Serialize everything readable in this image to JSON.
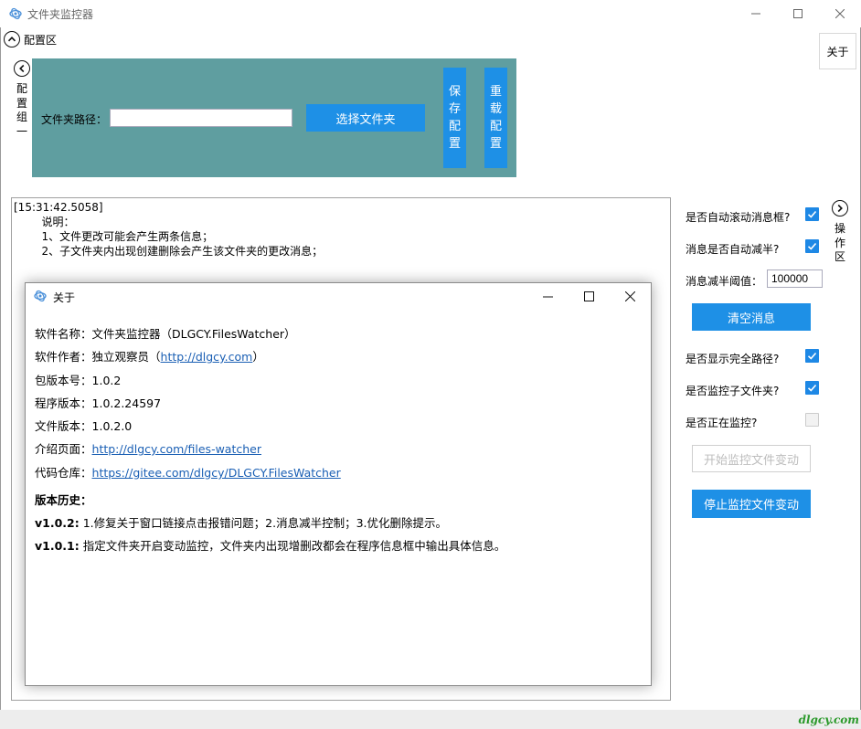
{
  "window": {
    "title": "文件夹监控器"
  },
  "config_area": {
    "header_label": "配置区",
    "group_label": "配置组一",
    "path_label": "文件夹路径：",
    "path_value": "",
    "select_folder_button": "选择文件夹",
    "save_config_button": "保存配置",
    "reload_config_button": "重载配置"
  },
  "about_button": "关于",
  "log": {
    "lines": [
      "[15:31:42.5058]",
      "        说明：",
      "        1、文件更改可能会产生两条信息；",
      "        2、子文件夹内出现创建删除会产生该文件夹的更改消息；"
    ]
  },
  "operation_area": {
    "label": "操作区",
    "auto_scroll_label": "是否自动滚动消息框?",
    "auto_scroll_checked": true,
    "auto_halve_label": "消息是否自动减半?",
    "auto_halve_checked": true,
    "halve_threshold_label": "消息减半阈值：",
    "halve_threshold_value": "100000",
    "clear_button": "清空消息",
    "show_full_path_label": "是否显示完全路径?",
    "show_full_path_checked": true,
    "monitor_subfolders_label": "是否监控子文件夹?",
    "monitor_subfolders_checked": true,
    "is_monitoring_label": "是否正在监控?",
    "is_monitoring_checked": false,
    "start_button": "开始监控文件变动",
    "stop_button": "停止监控文件变动"
  },
  "about_dialog": {
    "title": "关于",
    "software_name_label": "软件名称：",
    "software_name_value": "文件夹监控器（DLGCY.FilesWatcher）",
    "author_label": "软件作者：",
    "author_value": "独立观察员（",
    "author_link": "http://dlgcy.com",
    "author_close": "）",
    "package_version_label": "包版本号：",
    "package_version_value": "1.0.2",
    "program_version_label": "程序版本：",
    "program_version_value": "1.0.2.24597",
    "file_version_label": "文件版本：",
    "file_version_value": "1.0.2.0",
    "intro_page_label": "介绍页面：",
    "intro_page_link": "http://dlgcy.com/files-watcher",
    "repo_label": "代码仓库：",
    "repo_link": "https://gitee.com/dlgcy/DLGCY.FilesWatcher",
    "history_heading": "版本历史：",
    "history": [
      {
        "version": "v1.0.2:",
        "note": " 1.修复关于窗口链接点击报错问题；2.消息减半控制；3.优化删除提示。"
      },
      {
        "version": "v1.0.1:",
        "note": " 指定文件夹开启变动监控，文件夹内出现增删改都会在程序信息框中输出具体信息。"
      }
    ]
  },
  "watermark": "dlgcy.com",
  "colors": {
    "accent_blue": "#1e90e6",
    "config_panel": "#5f9ea0",
    "checkbox_blue": "#1e88e5",
    "link": "#1a5fb4"
  }
}
